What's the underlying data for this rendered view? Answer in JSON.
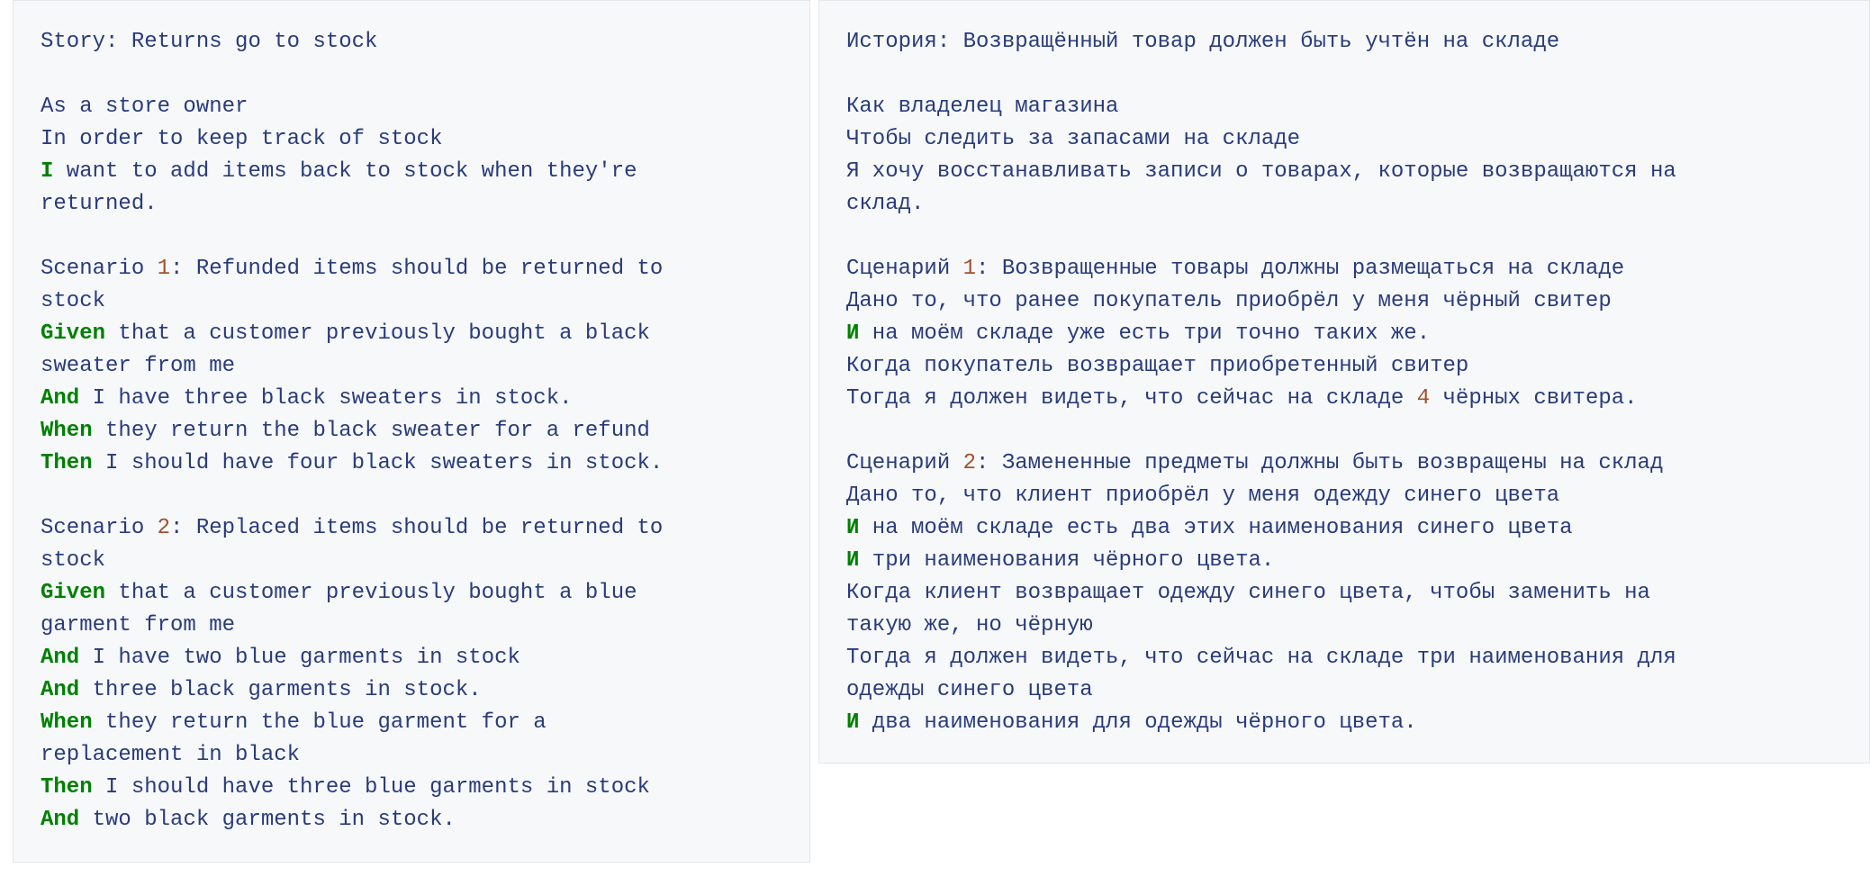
{
  "english": {
    "story_title": "Story: Returns go to stock",
    "as_a": "As a store owner",
    "in_order_to": "In order to keep track of stock",
    "want_kw": "I",
    "want_rest_1": " want to add items back to stock when they're",
    "want_rest_2": "returned.",
    "scenario1": {
      "prefix": "Scenario ",
      "number": "1",
      "title_1": ": Refunded items should be returned to",
      "title_2": "stock",
      "given_kw": "Given",
      "given_1": " that a customer previously bought a black",
      "given_2": "sweater from me",
      "and_kw": "And",
      "and_text": " I have three black sweaters in stock.",
      "when_kw": "When",
      "when_text": " they return the black sweater for a refund",
      "then_kw": "Then",
      "then_text": " I should have four black sweaters in stock."
    },
    "scenario2": {
      "prefix": "Scenario ",
      "number": "2",
      "title_1": ": Replaced items should be returned to",
      "title_2": "stock",
      "given_kw": "Given",
      "given_1": " that a customer previously bought a blue",
      "given_2": "garment from me",
      "and1_kw": "And",
      "and1_text": " I have two blue garments in stock",
      "and2_kw": "And",
      "and2_text": " three black garments in stock.",
      "when_kw": "When",
      "when_1": " they return the blue garment for a",
      "when_2": "replacement in black",
      "then_kw": "Then",
      "then_text": " I should have three blue garments in stock",
      "and3_kw": "And",
      "and3_text": " two black garments in stock."
    }
  },
  "russian": {
    "story_title": "История: Возвращённый товар должен быть учтён на складе",
    "as_a": "Как владелец магазина",
    "in_order_to": "Чтобы следить за запасами на складе",
    "want_1": "Я хочу восстанавливать записи о товарах, которые возвращаются на",
    "want_2": "склад.",
    "scenario1": {
      "prefix": "Сценарий ",
      "number": "1",
      "title": ": Возвращенные товары должны размещаться на складе",
      "given": "Дано то, что ранее покупатель приобрёл у меня чёрный свитер",
      "and_kw": "И",
      "and_text": " на моём складе уже есть три точно таких же.",
      "when": "Когда покупатель возвращает приобретенный свитер",
      "then_before": "Тогда я должен видеть, что сейчас на складе ",
      "then_number": "4",
      "then_after": " чёрных свитера."
    },
    "scenario2": {
      "prefix": "Сценарий ",
      "number": "2",
      "title": ": Замененные предметы должны быть возвращены на склад",
      "given": "Дано то, что клиент приобрёл у меня одежду синего цвета",
      "and1_kw": "И",
      "and1_text": " на моём складе есть два этих наименования синего цвета",
      "and2_kw": "И",
      "and2_text": " три наименования чёрного цвета.",
      "when_1": "Когда клиент возвращает одежду синего цвета, чтобы заменить на",
      "when_2": "такую же, но чёрную",
      "then_1": "Тогда я должен видеть, что сейчас на складе три наименования для",
      "then_2": "одежды синего цвета",
      "and3_kw": "И",
      "and3_text": " два наименования для одежды чёрного цвета."
    }
  },
  "colors": {
    "text": "#2a3b7b",
    "keyword": "#008000",
    "number": "#a0522d",
    "panel_background": "#f6f8fa",
    "panel_border": "#e4e7ea"
  }
}
